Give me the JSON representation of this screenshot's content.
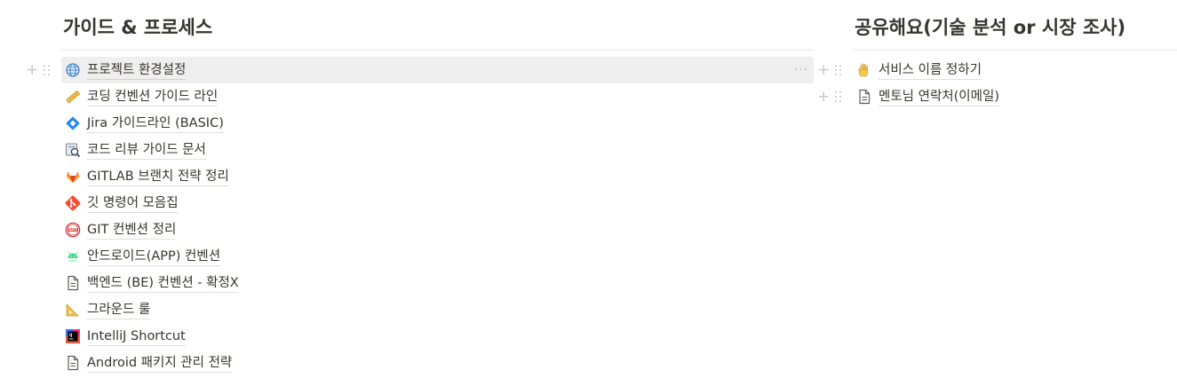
{
  "left": {
    "title": "가이드 & 프로세스",
    "items": [
      {
        "label": "프로젝트 환경설정",
        "icon": "globe-icon"
      },
      {
        "label": "코딩 컨벤션 가이드 라인",
        "icon": "ruler-icon"
      },
      {
        "label": "Jira 가이드라인 (BASIC)",
        "icon": "jira-icon"
      },
      {
        "label": "코드 리뷰 가이드 문서",
        "icon": "code-review-icon"
      },
      {
        "label": "GITLAB 브랜치 전략 정리",
        "icon": "gitlab-icon"
      },
      {
        "label": "깃 명령어 모음집",
        "icon": "git-icon"
      },
      {
        "label": "GIT 컨벤션 정리",
        "icon": "ways-badge-icon"
      },
      {
        "label": "안드로이드(APP) 컨벤션",
        "icon": "android-icon"
      },
      {
        "label": "백엔드 (BE) 컨벤션 - 확정X",
        "icon": "page-icon"
      },
      {
        "label": "그라운드 룰",
        "icon": "triangle-ruler-icon"
      },
      {
        "label": "IntelliJ Shortcut",
        "icon": "intellij-icon"
      },
      {
        "label": "Android 패키지 관리 전략",
        "icon": "page-icon"
      }
    ],
    "more_label": "···"
  },
  "right": {
    "title": "공유해요(기술 분석 or 시장 조사)",
    "items": [
      {
        "label": "서비스 이름 정하기",
        "icon": "raised-hand-icon"
      },
      {
        "label": "멘토님 연락처(이메일)",
        "icon": "page-icon"
      }
    ]
  },
  "controls": {
    "plus": "+"
  },
  "colors": {
    "text": "#37352f",
    "hover": "#efefef",
    "divider": "#e9e9e7"
  }
}
